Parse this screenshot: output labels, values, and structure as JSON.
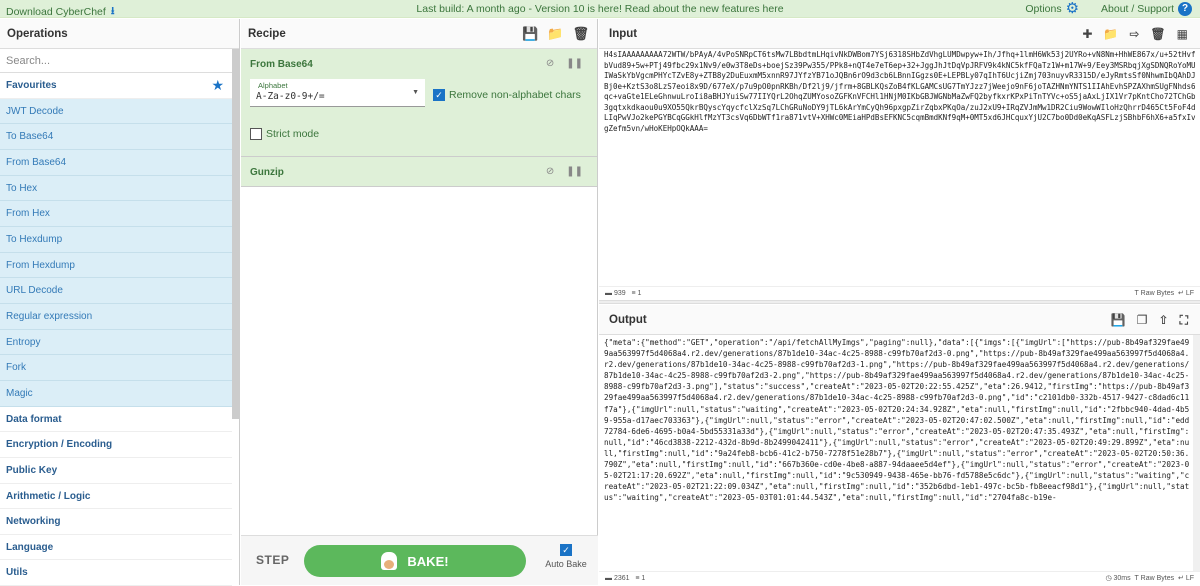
{
  "banner": {
    "download": "Download CyberChef",
    "build_notice": "Last build: A month ago - Version 10 is here! Read about the new features here",
    "options": "Options",
    "about": "About / Support",
    "about_icon": "?"
  },
  "operations": {
    "title": "Operations",
    "search_placeholder": "Search...",
    "favourites_label": "Favourites",
    "favourites": [
      "JWT Decode",
      "To Base64",
      "From Base64",
      "To Hex",
      "From Hex",
      "To Hexdump",
      "From Hexdump",
      "URL Decode",
      "Regular expression",
      "Entropy",
      "Fork",
      "Magic"
    ],
    "categories": [
      "Data format",
      "Encryption / Encoding",
      "Public Key",
      "Arithmetic / Logic",
      "Networking",
      "Language",
      "Utils"
    ]
  },
  "recipe": {
    "title": "Recipe",
    "from_base64": {
      "title": "From Base64",
      "alphabet_label": "Alphabet",
      "alphabet_value": "A-Za-z0-9+/=",
      "remove_label": "Remove non-alphabet chars",
      "strict_label": "Strict mode"
    },
    "gunzip": {
      "title": "Gunzip"
    },
    "step_label": "STEP",
    "bake_label": "BAKE!",
    "autobake_label": "Auto Bake"
  },
  "input": {
    "title": "Input",
    "text": "H4sIAAAAAAAAA72WTW/bPAyA/4vPoSNRpCT6tsMw7LBbdtmLHqivNkDWBom7YSj6318SHbZdVhgLUMDwpyw+Ih/Jfhq+1lmH6Wk53j2UYRo+vN8Nm+HhWE867x/u+52tHvfbVud89+5w+PTj49fbc29x1Nv9/e0w3T8eDs+boejSz39Pw355/PPk8+nQT4e7eT6ep+32+JggJhJtDqVpJRFV9k4kNC5kfFQaTz1W+m17W+9/Eey3MSRbqjXgSDNQRoYoMUIWaSkYbVgcmPHYcTZvE8y+ZTB8y2DuEuxmM5xnnR97JYfzYB71oJQBn6rO9d3cb6LBnnIGgzs0E+LEPBLy07qIhT6UcjiZmj703nuyvR3315D/eJyRmtsSf0NhwmIbQAhDJBj0e+KztS3o8LzS7eoi8x9D/677eX/p7u9pO0pnRKBh/Df2lj9/jfrm+8GBLKQsZoB4fKLGAMCsUG7TmYJzz7jWeejo9nF6joTAZHNmYNTS1IIAhEvhSPZAXhmSUgFNhds6qc+vaGte1ELeGhnwuLroIi8aBHJYuiSw77IIYQrL2OhqZUMYosoZGFKnVFCHl1HNjM0IKbGBJWGNbMaZwFQ2byfkxrKPxPiTnTYVc+oS5jaAxLjIX1Vr7pKntCho72TChGb3gqtxkdkaou0u9XO55QkrBQyscYqycfclXzSq7LChGRuNoDY9jTL6kArYmCyQh96pxgpZirZqbxPKqOa/zuJ2xU9+IRqZVJmMw1DR2Ciu9WowWIloHzQhrrD465Ct5FoF4dLIqPwVJo2kePGYBCqGGkHlfMzYT3csVq6DbWTf1ra871vtV+XHWc0MEiaHPdBsEFKNC5cqmBmdKNf9qM+0MT5xd6JHCquxYjU2C7bo0Dd0eKqASFLzjSBhbF6hX6+a5fxIvgZefm5vn/wHoKEHpOQkAAA=",
    "stat_length": "939",
    "stat_lines": "1",
    "stat_raw": "Raw Bytes",
    "stat_eol": "LF"
  },
  "output": {
    "title": "Output",
    "text": "{\"meta\":{\"method\":\"GET\",\"operation\":\"/api/fetchAllMyImgs\",\"paging\":null},\"data\":[{\"imgs\":[{\"imgUrl\":[\"https://pub-8b49af329fae499aa563997f5d4068a4.r2.dev/generations/87b1de10-34ac-4c25-8988-c99fb70af2d3-0.png\",\"https://pub-8b49af329fae499aa563997f5d4068a4.r2.dev/generations/87b1de10-34ac-4c25-8988-c99fb70af2d3-1.png\",\"https://pub-8b49af329fae499aa563997f5d4068a4.r2.dev/generations/87b1de10-34ac-4c25-8988-c99fb70af2d3-2.png\",\"https://pub-8b49af329fae499aa563997f5d4068a4.r2.dev/generations/87b1de10-34ac-4c25-8988-c99fb70af2d3-3.png\"],\"status\":\"success\",\"createAt\":\"2023-05-02T20:22:55.425Z\",\"eta\":26.9412,\"firstImg\":\"https://pub-8b49af329fae499aa563997f5d4068a4.r2.dev/generations/87b1de10-34ac-4c25-8988-c99fb70af2d3-0.png\",\"id\":\"c2101db0-332b-4517-9427-c8dad6c11f7a\"},{\"imgUrl\":null,\"status\":\"waiting\",\"createAt\":\"2023-05-02T20:24:34.928Z\",\"eta\":null,\"firstImg\":null,\"id\":\"2fbbc940-4dad-4b59-955a-d17aec703363\"},{\"imgUrl\":null,\"status\":\"error\",\"createAt\":\"2023-05-02T20:47:02.500Z\",\"eta\":null,\"firstImg\":null,\"id\":\"edd72784-6de6-4695-b0a4-5bd55331a33d\"},{\"imgUrl\":null,\"status\":\"error\",\"createAt\":\"2023-05-02T20:47:35.493Z\",\"eta\":null,\"firstImg\":null,\"id\":\"46cd3838-2212-432d-8b9d-8b2499042411\"},{\"imgUrl\":null,\"status\":\"error\",\"createAt\":\"2023-05-02T20:49:29.899Z\",\"eta\":null,\"firstImg\":null,\"id\":\"9a24feb8-bcb6-41c2-b750-7278f51e28b7\"},{\"imgUrl\":null,\"status\":\"error\",\"createAt\":\"2023-05-02T20:50:36.790Z\",\"eta\":null,\"firstImg\":null,\"id\":\"667b360e-cd0e-4be8-a887-94daaee5d4ef\"},{\"imgUrl\":null,\"status\":\"error\",\"createAt\":\"2023-05-02T21:17:20.692Z\",\"eta\":null,\"firstImg\":null,\"id\":\"9c530949-9438-465e-bb76-fd5788e5c6dc\"},{\"imgUrl\":null,\"status\":\"waiting\",\"createAt\":\"2023-05-02T21:22:09.034Z\",\"eta\":null,\"firstImg\":null,\"id\":\"352b6dbd-1eb1-497c-bc5b-fb8eeacf98d1\"},{\"imgUrl\":null,\"status\":\"waiting\",\"createAt\":\"2023-05-03T01:01:44.543Z\",\"eta\":null,\"firstImg\":null,\"id\":\"2704fa8c-b19e-",
    "stat_length": "2361",
    "stat_lines": "1",
    "stat_time": "30ms",
    "stat_raw": "Raw Bytes",
    "stat_eol": "LF"
  },
  "colors": {
    "accent": "#1a73c6",
    "recipe_bg": "#dff0d8",
    "favourite_bg": "#dbeef7",
    "bake": "#5cb85c"
  }
}
